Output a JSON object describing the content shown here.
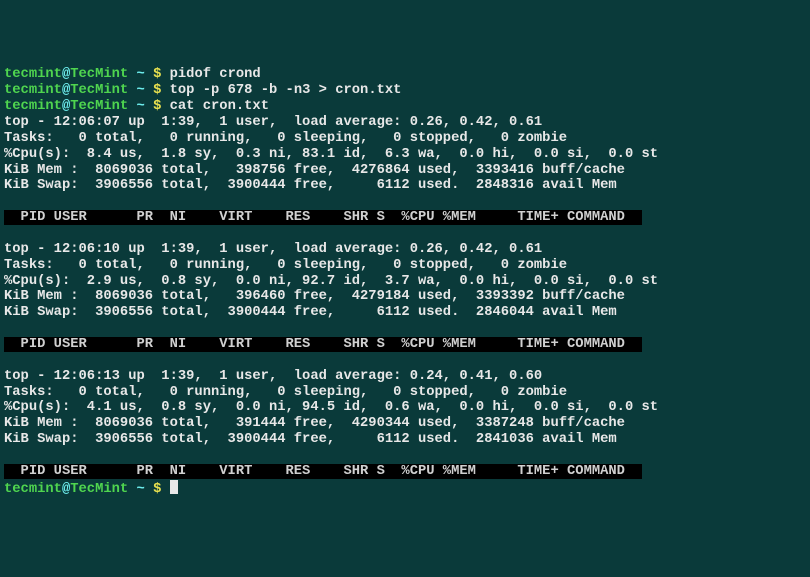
{
  "prompt": {
    "user": "tecmint",
    "host": "TecMint",
    "sep1": "@",
    "tilde": "~",
    "dollar": "$"
  },
  "cmds": {
    "pidof": "pidof crond",
    "top": "top -p 678 -b -n3 > cron.txt",
    "cat": "cat cron.txt"
  },
  "snaps": [
    {
      "topline": "top - 12:06:07 up  1:39,  1 user,  load average: 0.26, 0.42, 0.61",
      "tasks": "Tasks:   0 total,   0 running,   0 sleeping,   0 stopped,   0 zombie",
      "cpu": "%Cpu(s):  8.4 us,  1.8 sy,  0.3 ni, 83.1 id,  6.3 wa,  0.0 hi,  0.0 si,  0.0 st",
      "mem": "KiB Mem :  8069036 total,   398756 free,  4276864 used,  3393416 buff/cache",
      "swap": "KiB Swap:  3906556 total,  3900444 free,     6112 used.  2848316 avail Mem "
    },
    {
      "topline": "top - 12:06:10 up  1:39,  1 user,  load average: 0.26, 0.42, 0.61",
      "tasks": "Tasks:   0 total,   0 running,   0 sleeping,   0 stopped,   0 zombie",
      "cpu": "%Cpu(s):  2.9 us,  0.8 sy,  0.0 ni, 92.7 id,  3.7 wa,  0.0 hi,  0.0 si,  0.0 st",
      "mem": "KiB Mem :  8069036 total,   396460 free,  4279184 used,  3393392 buff/cache",
      "swap": "KiB Swap:  3906556 total,  3900444 free,     6112 used.  2846044 avail Mem "
    },
    {
      "topline": "top - 12:06:13 up  1:39,  1 user,  load average: 0.24, 0.41, 0.60",
      "tasks": "Tasks:   0 total,   0 running,   0 sleeping,   0 stopped,   0 zombie",
      "cpu": "%Cpu(s):  4.1 us,  0.8 sy,  0.0 ni, 94.5 id,  0.6 wa,  0.0 hi,  0.0 si,  0.0 st",
      "mem": "KiB Mem :  8069036 total,   391444 free,  4290344 used,  3387248 buff/cache",
      "swap": "KiB Swap:  3906556 total,  3900444 free,     6112 used.  2841036 avail Mem "
    }
  ],
  "header": "  PID USER      PR  NI    VIRT    RES    SHR S  %CPU %MEM     TIME+ COMMAND  "
}
